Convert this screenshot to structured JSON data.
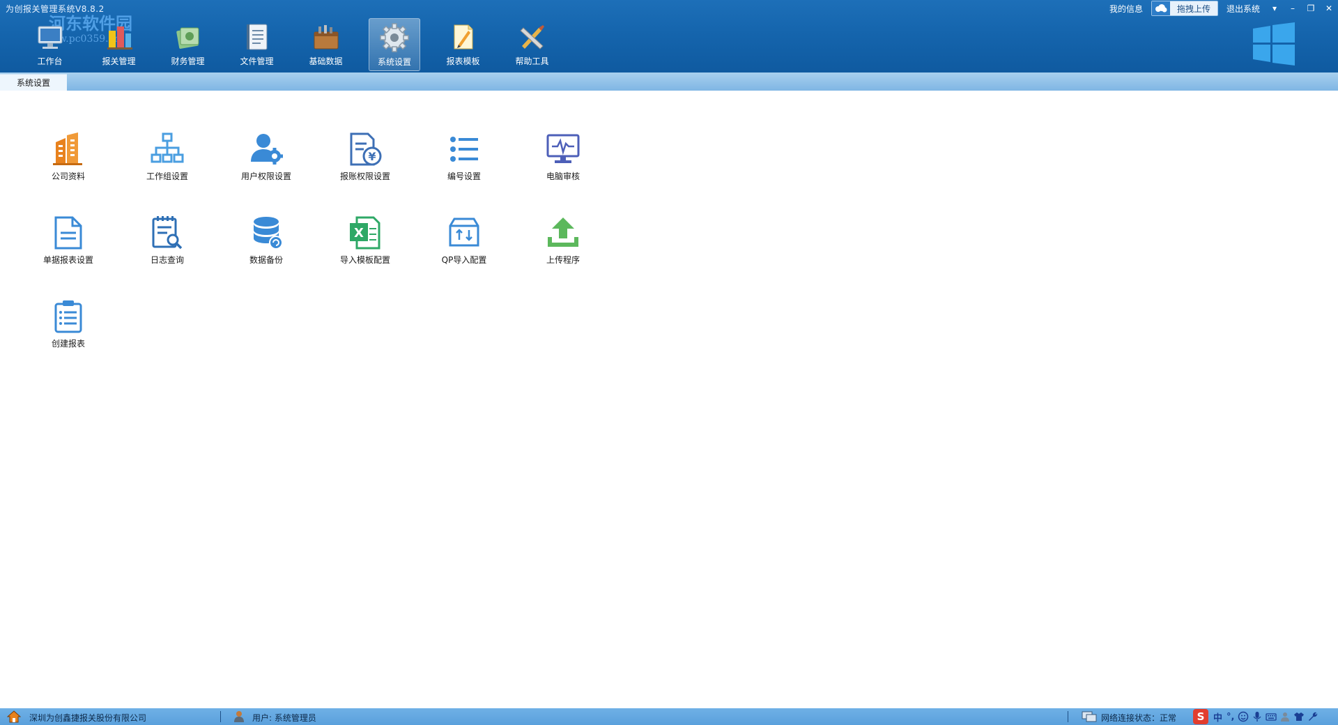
{
  "app": {
    "title": "为创报关管理系统V8.8.2",
    "watermark": "河东软件园",
    "watermark_url": "www.pc0359.cn"
  },
  "toolbar": {
    "items": [
      {
        "label": "工作台",
        "icon": "workbench-icon"
      },
      {
        "label": "报关管理",
        "icon": "customs-icon"
      },
      {
        "label": "财务管理",
        "icon": "finance-icon"
      },
      {
        "label": "文件管理",
        "icon": "file-icon"
      },
      {
        "label": "基础数据",
        "icon": "toolbox-icon"
      },
      {
        "label": "系统设置",
        "icon": "gear-icon",
        "active": true
      },
      {
        "label": "报表模板",
        "icon": "report-icon"
      },
      {
        "label": "帮助工具",
        "icon": "tools-icon"
      }
    ]
  },
  "top_right": {
    "my_info": "我的信息",
    "upload": "拖拽上传",
    "exit": "退出系统"
  },
  "tabs": [
    {
      "label": "系统设置",
      "active": true
    }
  ],
  "grid": {
    "items": [
      {
        "label": "公司资料",
        "icon": "building-icon",
        "color": "#e8821e"
      },
      {
        "label": "工作组设置",
        "icon": "org-chart-icon",
        "color": "#4a9ee0"
      },
      {
        "label": "用户权限设置",
        "icon": "user-gear-icon",
        "color": "#3a8ad6"
      },
      {
        "label": "报账权限设置",
        "icon": "yen-document-icon",
        "color": "#3d6fb5"
      },
      {
        "label": "编号设置",
        "icon": "list-icon",
        "color": "#3a8ad6"
      },
      {
        "label": "电脑审核",
        "icon": "monitor-icon",
        "color": "#4d5fb8"
      },
      {
        "label": "单据报表设置",
        "icon": "document-icon",
        "color": "#3a8ad6"
      },
      {
        "label": "日志查询",
        "icon": "log-search-icon",
        "color": "#2e6fb5"
      },
      {
        "label": "数据备份",
        "icon": "database-icon",
        "color": "#3a8ad6"
      },
      {
        "label": "导入模板配置",
        "icon": "excel-icon",
        "color": "#2ea866"
      },
      {
        "label": "QP导入配置",
        "icon": "import-box-icon",
        "color": "#3a8ad6"
      },
      {
        "label": "上传程序",
        "icon": "upload-icon",
        "color": "#5cb85c"
      },
      {
        "label": "创建报表",
        "icon": "clipboard-icon",
        "color": "#3a8ad6"
      }
    ]
  },
  "status": {
    "company": "深圳为创鑫捷报关股份有限公司",
    "user": "用户: 系统管理员",
    "network": "网络连接状态：正常",
    "ime_lang": "中"
  }
}
